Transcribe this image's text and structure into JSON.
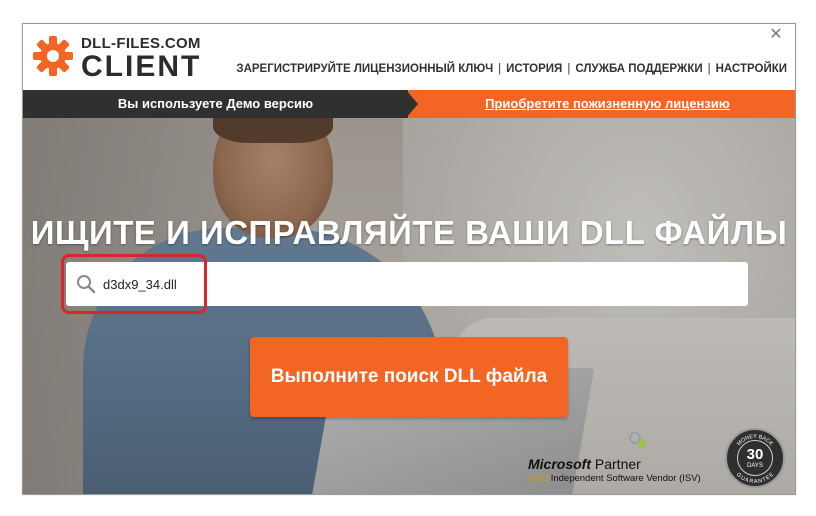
{
  "app": {
    "logo_line1": "DLL-FILES.COM",
    "logo_line2": "CLIENT",
    "close_glyph": "✕"
  },
  "nav": {
    "items": [
      "ЗАРЕГИСТРИРУЙТЕ ЛИЦЕНЗИОННЫЙ КЛЮЧ",
      "ИСТОРИЯ",
      "СЛУЖБА ПОДДЕРЖКИ",
      "НАСТРОЙКИ"
    ],
    "separator": "|"
  },
  "banner": {
    "demo_text": "Вы используете Демо версию",
    "buy_link": "Приобретите пожизненную лицензию"
  },
  "hero": {
    "headline": "ИЩИТЕ И ИСПРАВЛЯЙТЕ ВАШИ DLL ФАЙЛЫ"
  },
  "search": {
    "value": "d3dx9_34.dll",
    "button_label": "Выполните поиск DLL файла"
  },
  "partner": {
    "ms_brand": "Microsoft",
    "ms_partner": "Partner",
    "tier": "Gold",
    "description": "Independent Software Vendor (ISV)"
  },
  "badge": {
    "number": "30",
    "days": "DAYS",
    "top_text": "MONEY BACK",
    "bottom_text": "GUARANTEE"
  },
  "colors": {
    "accent": "#f26522",
    "dark_banner": "#303030",
    "highlight_red": "#d9262a"
  },
  "icons": {
    "logo": "gear-logo-icon",
    "search": "magnifier-icon",
    "close": "close-icon"
  }
}
